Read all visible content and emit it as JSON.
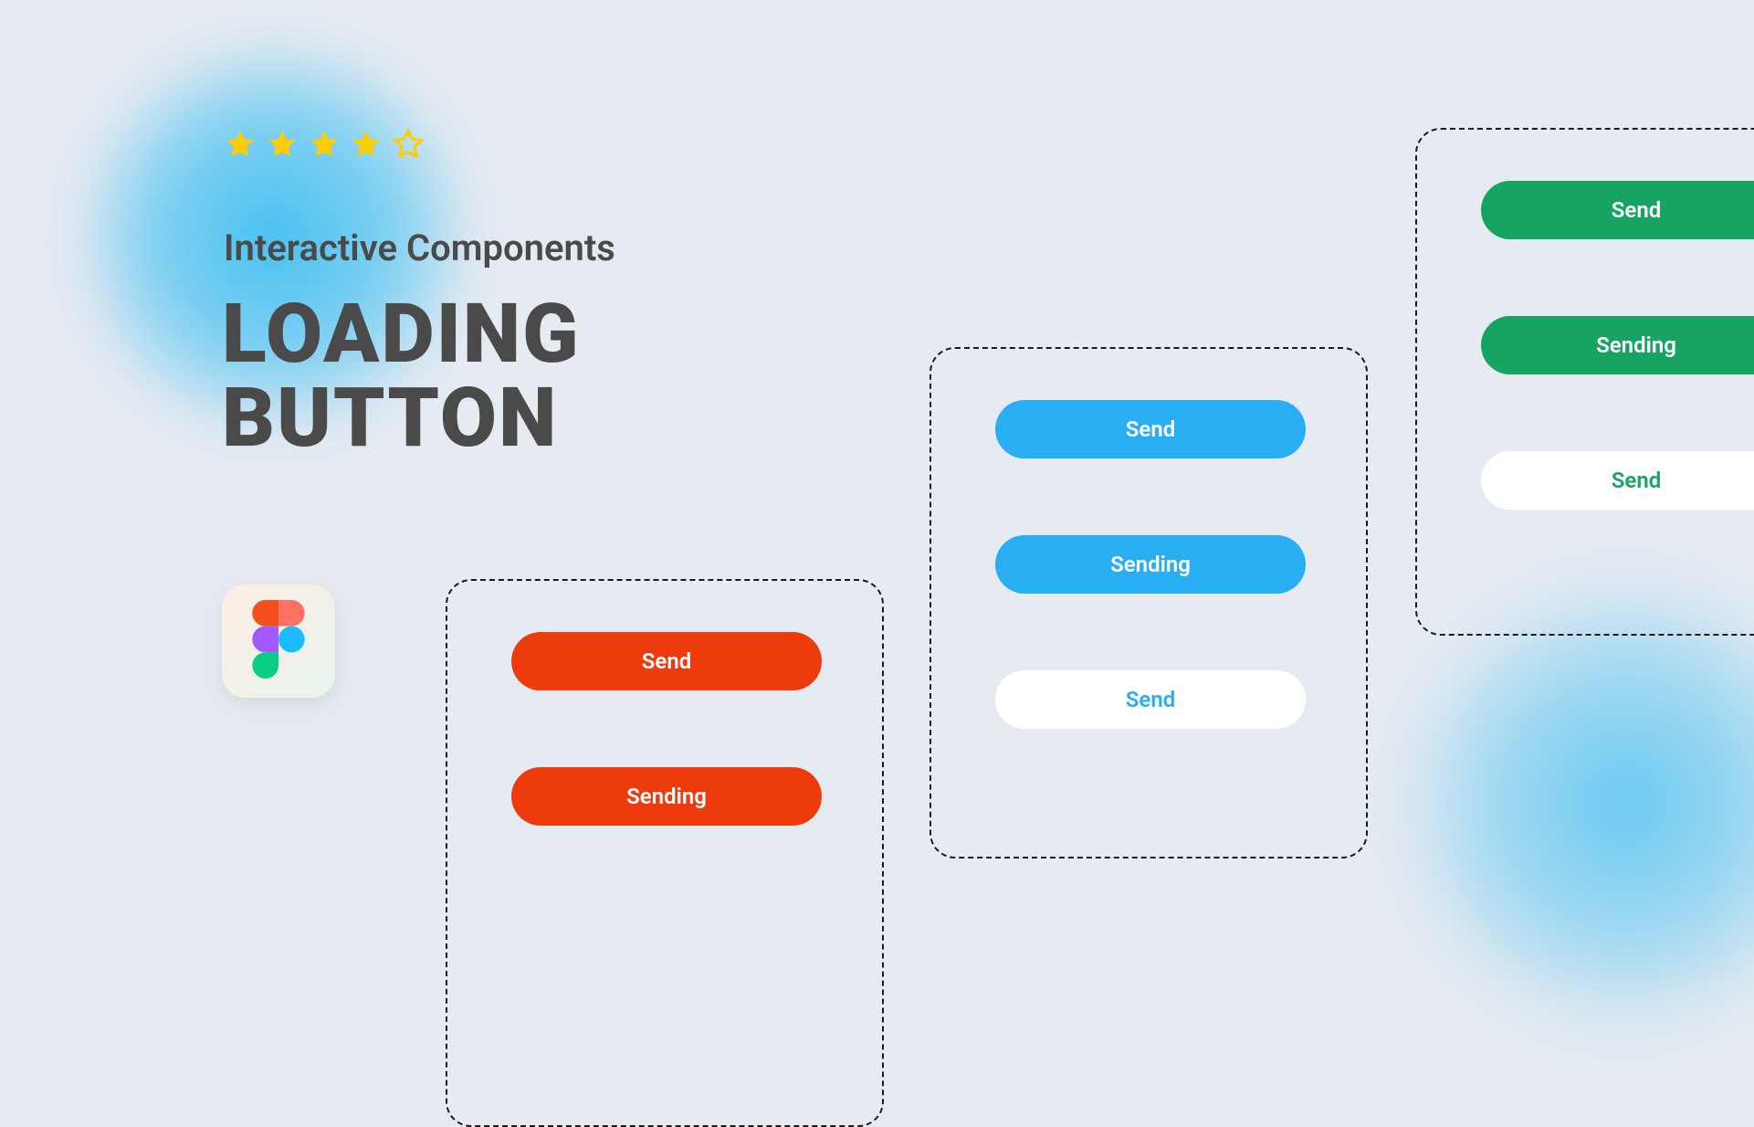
{
  "rating": {
    "filled": 4,
    "total": 5
  },
  "subtitle": "Interactive Components",
  "title_line1": "LOADING",
  "title_line2": "BUTTON",
  "colors": {
    "red": "#ee3b0d",
    "blue": "#29aef3",
    "green": "#16a462",
    "background": "#e6ebf2",
    "star": "#ffcc00"
  },
  "panels": {
    "red": {
      "buttons": [
        {
          "label": "Send",
          "variant": "red"
        },
        {
          "label": "Sending",
          "variant": "red"
        }
      ]
    },
    "blue": {
      "buttons": [
        {
          "label": "Send",
          "variant": "blue"
        },
        {
          "label": "Sending",
          "variant": "blue"
        },
        {
          "label": "Send",
          "variant": "white-blue"
        }
      ]
    },
    "green": {
      "buttons": [
        {
          "label": "Send",
          "variant": "green"
        },
        {
          "label": "Sending",
          "variant": "green"
        },
        {
          "label": "Send",
          "variant": "white-green"
        }
      ]
    }
  },
  "icons": {
    "figma": "figma-logo"
  }
}
